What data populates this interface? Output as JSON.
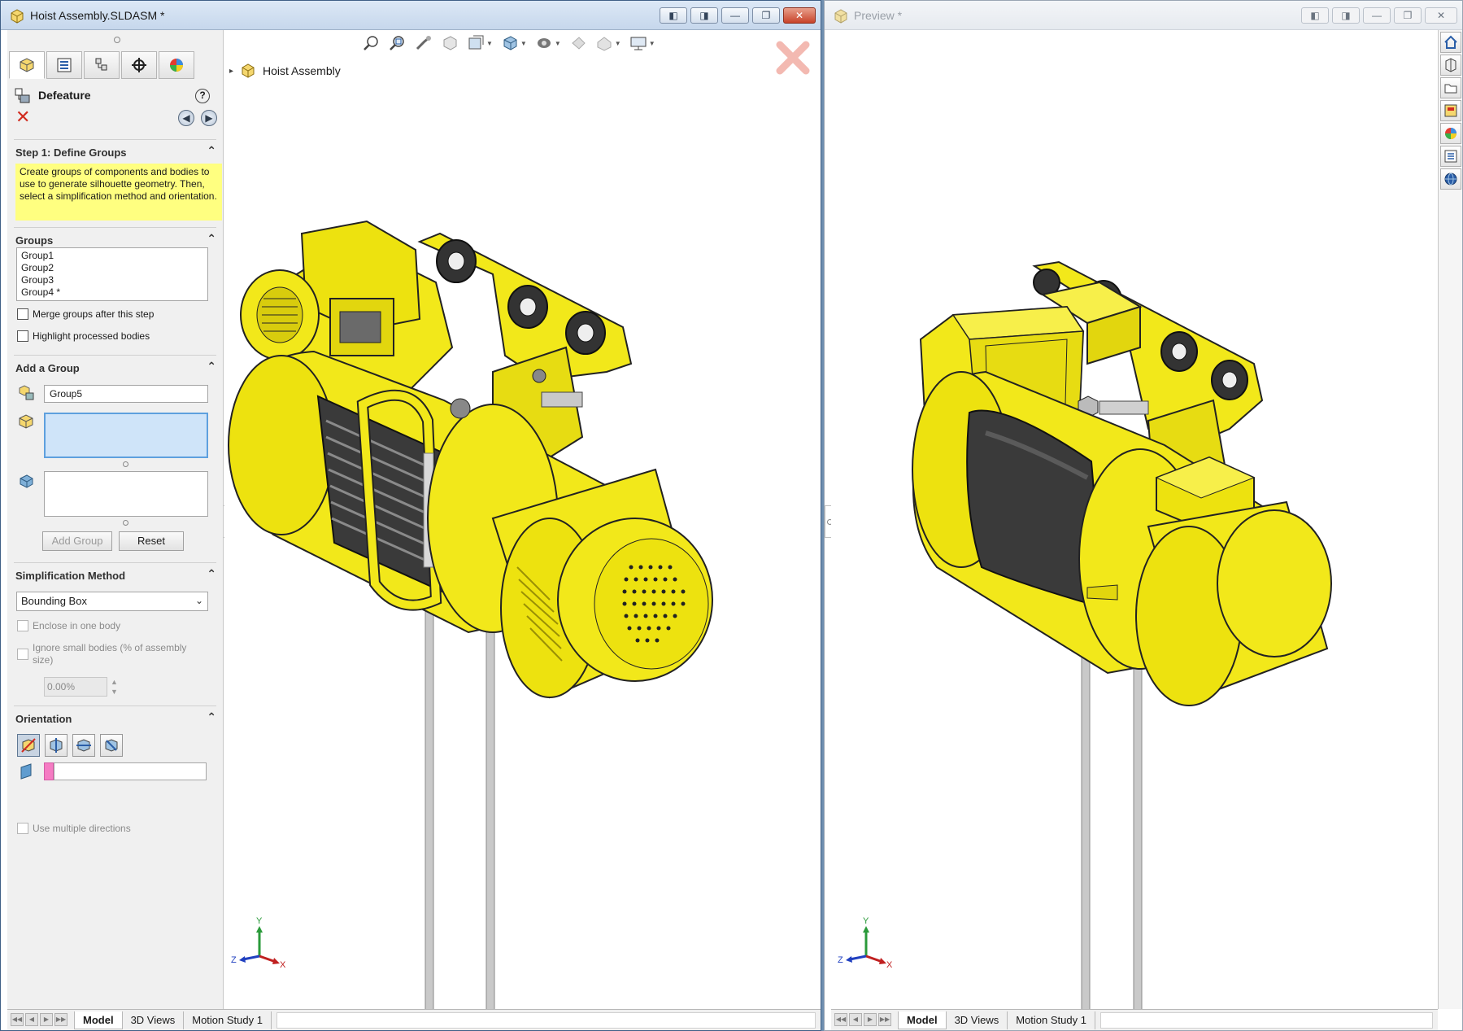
{
  "left_window": {
    "title": "Hoist Assembly.SLDASM *",
    "window_buttons": [
      "◧",
      "◨",
      "—",
      "❐",
      "✕"
    ]
  },
  "right_window": {
    "title": "Preview *",
    "window_buttons": [
      "◧",
      "◨",
      "—",
      "❐",
      "✕"
    ]
  },
  "property_manager": {
    "title": "Defeature",
    "help": "?",
    "cancel": "✕",
    "back_arrow": "◀",
    "next_arrow": "▶",
    "step1": {
      "header": "Step 1: Define Groups",
      "tip": "Create groups of components and bodies to use to generate silhouette geometry. Then, select a simplification method and orientation."
    },
    "groups": {
      "header": "Groups",
      "items": [
        "Group1",
        "Group2",
        "Group3",
        "Group4 *"
      ],
      "merge_label": "Merge groups after this step",
      "highlight_label": "Highlight processed bodies"
    },
    "add_group": {
      "header": "Add a Group",
      "name_value": "Group5",
      "add_button": "Add Group",
      "reset_button": "Reset"
    },
    "simplification": {
      "header": "Simplification Method",
      "selected": "Bounding Box",
      "enclose_label": "Enclose in one body",
      "ignore_label": "Ignore small bodies (% of assembly size)",
      "percent_value": "0.00%"
    },
    "orientation": {
      "header": "Orientation",
      "multiple_label": "Use multiple directions"
    },
    "collapse_glyph": "⌃"
  },
  "feature_tree": {
    "root": "Hoist Assembly",
    "expand_glyph": "▸"
  },
  "triad": {
    "x": "X",
    "y": "Y",
    "z": "Z"
  },
  "bottom_tabs": [
    "Model",
    "3D Views",
    "Motion Study 1"
  ],
  "scroll_nav": [
    "◀◀",
    "◀",
    "▶",
    "▶▶"
  ],
  "colors": {
    "model_yellow": "#f2e81a",
    "model_dark_yellow": "#b8ae0a",
    "tip_yellow": "#ffff80",
    "selection_blue": "#cfe4f9",
    "cancel_red": "#d12b1f",
    "orientation_pink": "#f57cc3"
  }
}
